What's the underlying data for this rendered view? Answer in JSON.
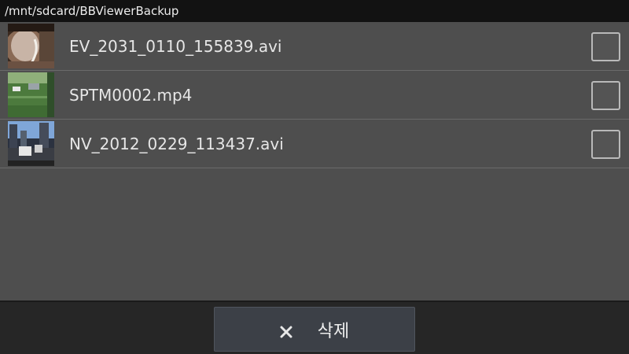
{
  "header": {
    "path": "/mnt/sdcard/BBViewerBackup"
  },
  "files": [
    {
      "name": "EV_2031_0110_155839.avi",
      "thumbnail": "car-interior-thumbnail",
      "checked": false
    },
    {
      "name": "SPTM0002.mp4",
      "thumbnail": "field-camera-thumbnail",
      "checked": false
    },
    {
      "name": "NV_2012_0229_113437.avi",
      "thumbnail": "city-street-thumbnail",
      "checked": false
    }
  ],
  "footer": {
    "delete_label": "삭제",
    "delete_icon": "close-icon"
  },
  "colors": {
    "path_bar": "#121212",
    "list_bg": "#4e4e4e",
    "button_bg": "#3c4047"
  }
}
